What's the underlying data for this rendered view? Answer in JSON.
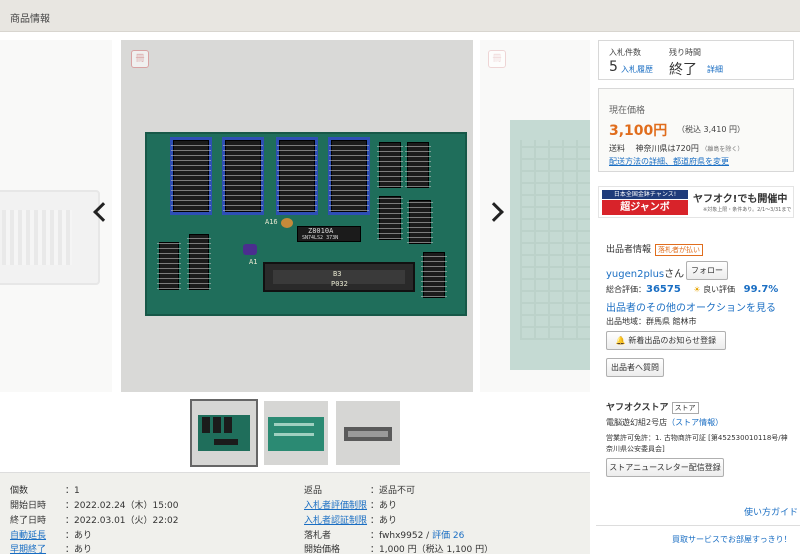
{
  "header": {
    "title": "商品情報"
  },
  "gallery": {
    "prev_arrow": "‹",
    "next_arrow": "›",
    "board": {
      "ic1_label": "Z8010A",
      "ic2_label": "SN74LS2 373N",
      "connector_label": "P032",
      "b3_label": "B3",
      "a1_label": "A1",
      "a16_label": "A16"
    },
    "thumbnail_count": 3
  },
  "details": {
    "left": [
      {
        "key": "個数",
        "value": "：1",
        "link": false
      },
      {
        "key": "開始日時",
        "value": "：2022.02.24（木）15:00",
        "link": false
      },
      {
        "key": "終了日時",
        "value": "：2022.03.01（火）22:02",
        "link": false
      },
      {
        "key": "自動延長",
        "value": "：あり",
        "link": true
      },
      {
        "key": "早期終了",
        "value": "：あり",
        "link": true
      }
    ],
    "right": [
      {
        "key": "返品",
        "value": "：返品不可",
        "link": false
      },
      {
        "key": "入札者評価制限",
        "value": "：あり",
        "link": true
      },
      {
        "key": "入札者認証制限",
        "value": "：あり",
        "link": true
      },
      {
        "key": "落札者",
        "value": "：fwhx9952 / ",
        "link": false,
        "extra": "評価 26"
      },
      {
        "key": "開始価格",
        "value": "：1,000 円（税込 1,100 円）",
        "link": false
      }
    ]
  },
  "bid": {
    "count_label": "入札件数",
    "count_value": "5",
    "history_link": "入札履歴",
    "time_label": "残り時間",
    "time_value": "終了",
    "detail_link": "詳細"
  },
  "price": {
    "label": "現在価格",
    "value": "3,100円",
    "tax": "（税込 3,410 円）",
    "shipping_label": "送料",
    "shipping_text": "神奈川県は720円",
    "shipping_note": "（離島を除く）",
    "shipping_link": "配送方法の詳細、都道府県を変更"
  },
  "banner": {
    "top_text": "日本全国金鉢チャンス!",
    "main_text": "超ジャンボ",
    "right_text": "ヤフオク!でも開催中",
    "note": "※対象上限・条件あり。2/1～3/31まで"
  },
  "seller": {
    "section_title": "出品者情報",
    "badge": "落札者が払い",
    "name": "yugen2plus",
    "name_suffix": "さん",
    "follow_button": "フォロー",
    "total_label": "総合評価：",
    "total_value": "36575",
    "good_label": "良い評価",
    "good_value": "99.7%",
    "other_auctions": "出品者のその他のオークションを見る",
    "area": "出品地域：群馬県 館林市",
    "notify_button": "新着出品のお知らせ登録",
    "question_button": "出品者へ質問"
  },
  "store": {
    "title": "ヤフオクストア",
    "store_badge": "ストア",
    "name": "電脳遊幻組2号店",
    "info_link": "（ストア情報）",
    "permit_label": "営業許可免許：",
    "permit_value": "1. 古物商許可証 [第452530010118号/神奈川県公安委員会]",
    "newsletter_button": "ストアニュースレター配信登録"
  },
  "footer": {
    "help": "使い方ガイド",
    "bottom_banner": "買取サービスでお部屋すっきり！"
  }
}
